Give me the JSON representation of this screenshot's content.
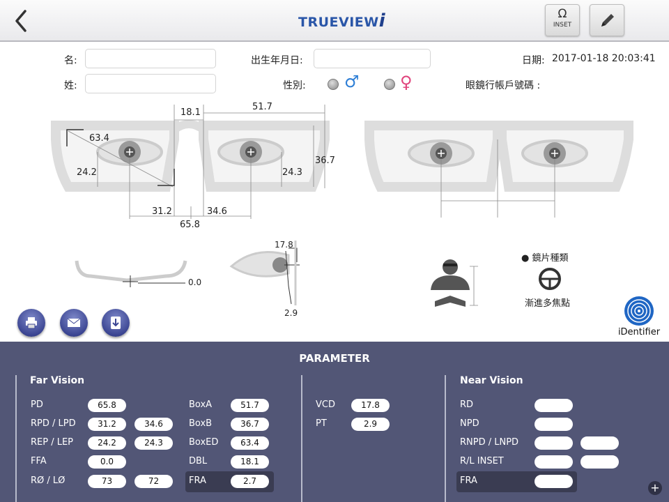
{
  "header": {
    "logo_main": "TRUEVIEW",
    "logo_suffix": "i",
    "inset_label": "INSET"
  },
  "form": {
    "first_name_label": "名:",
    "last_name_label": "姓:",
    "dob_label": "出生年月日:",
    "gender_label": "性別:",
    "date_label": "日期:",
    "date_value": "2017-01-18 20:03:41",
    "account_label": "眼鏡行帳戶號碼 :",
    "male_symbol": "♂",
    "female_symbol": "♀",
    "colors": {
      "male": "#2f7fd6",
      "female": "#e0457d"
    }
  },
  "diagram": {
    "pd_total": "65.8",
    "rpd": "31.2",
    "lpd": "34.6",
    "dbl": "18.1",
    "box_a": "51.7",
    "box_b": "36.7",
    "boxed": "63.4",
    "rep": "24.2",
    "lep": "24.3",
    "ffa": "0.0",
    "vcd": "17.8",
    "pt": "2.9",
    "lens_type_label": "● 鏡片種類",
    "lens_type_value": "漸進多焦點"
  },
  "actions": {
    "identifier_label": "iDentifier"
  },
  "parameter": {
    "title": "PARAMETER",
    "far_title": "Far Vision",
    "near_title": "Near Vision",
    "far_rows": [
      {
        "label": "PD",
        "v1": "65.8"
      },
      {
        "label": "RPD / LPD",
        "v1": "31.2",
        "v2": "34.6"
      },
      {
        "label": "REP / LEP",
        "v1": "24.2",
        "v2": "24.3"
      },
      {
        "label": "FFA",
        "v1": "0.0"
      },
      {
        "label": "RØ / LØ",
        "v1": "73",
        "v2": "72"
      }
    ],
    "box_rows": [
      {
        "label": "BoxA",
        "v1": "51.7"
      },
      {
        "label": "BoxB",
        "v1": "36.7"
      },
      {
        "label": "BoxED",
        "v1": "63.4"
      },
      {
        "label": "DBL",
        "v1": "18.1"
      },
      {
        "label": "FRA",
        "v1": "2.7"
      }
    ],
    "mid_rows": [
      {
        "label": "VCD",
        "v1": "17.8"
      },
      {
        "label": "PT",
        "v1": "2.9"
      }
    ],
    "near_rows": [
      {
        "label": "RD",
        "v1": ""
      },
      {
        "label": "NPD",
        "v1": ""
      },
      {
        "label": "RNPD / LNPD",
        "v1": "",
        "v2": ""
      },
      {
        "label": "R/L INSET",
        "v1": "",
        "v2": ""
      },
      {
        "label": "FRA",
        "v1": ""
      }
    ]
  }
}
